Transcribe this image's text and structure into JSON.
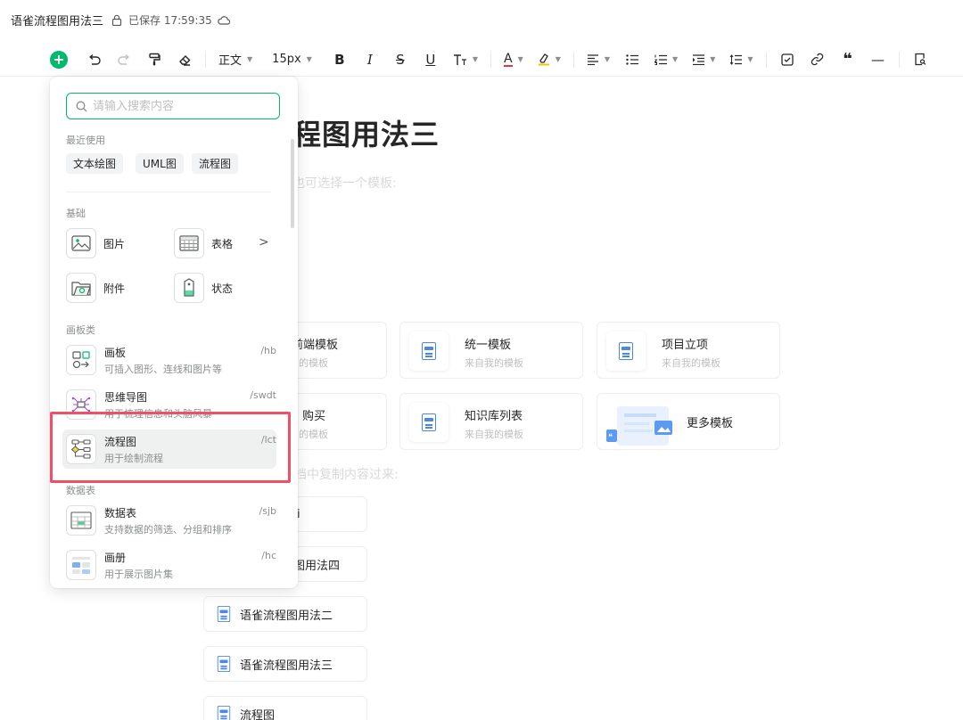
{
  "titlebar": {
    "title": "语雀流程图用法三",
    "saved": "已保存 17:59:35"
  },
  "toolbar": {
    "text_style": "正文",
    "font_size": "15px",
    "bold": "B",
    "italic": "I",
    "strike": "S",
    "underline": "U",
    "font_color": "A",
    "quote": "❝",
    "hr": "—"
  },
  "document": {
    "heading": "程图用法三",
    "hint_templates": "也可选择一个模板:",
    "hint_copy": "档中复制内容过来:",
    "templates": [
      {
        "name": "前端模板",
        "sub": "的模板"
      },
      {
        "name": "统一模板",
        "sub": "来自我的模板"
      },
      {
        "name": "项目立项",
        "sub": "来自我的模板"
      },
      {
        "name": "购买",
        "sub": "的模板"
      },
      {
        "name": "知识库列表",
        "sub": "来自我的模板"
      },
      {
        "name": "更多模板",
        "sub": ""
      }
    ],
    "recent_docs": [
      "i",
      "图用法四",
      "语雀流程图用法二",
      "语雀流程图用法三",
      "流程图"
    ]
  },
  "menu": {
    "search_placeholder": "请输入搜索内容",
    "recent_label": "最近使用",
    "recent": [
      "文本绘图",
      "UML图",
      "流程图"
    ],
    "basic_label": "基础",
    "basic": [
      "图片",
      "表格",
      "附件",
      "状态"
    ],
    "board_label": "画板类",
    "board_items": [
      {
        "title": "画板",
        "desc": "可插入图形、连线和图片等",
        "shortcut": "/hb"
      },
      {
        "title": "思维导图",
        "desc": "用于梳理信息和头脑风暴",
        "shortcut": "/swdt"
      },
      {
        "title": "流程图",
        "desc": "用于绘制流程",
        "shortcut": "/lct"
      }
    ],
    "data_label": "数据表",
    "data_items": [
      {
        "title": "数据表",
        "desc": "支持数据的筛选、分组和排序",
        "shortcut": "/sjb"
      },
      {
        "title": "画册",
        "desc": "用于展示图片集",
        "shortcut": "/hc"
      }
    ]
  },
  "colors": {
    "accent": "#00b96b",
    "highlight": "#ef4f67",
    "doc_icon": "#4a87e6"
  }
}
